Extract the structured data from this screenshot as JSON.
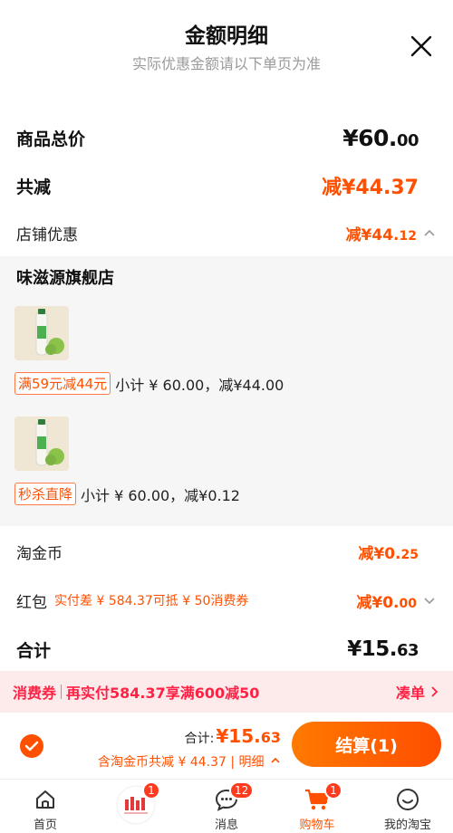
{
  "header": {
    "title": "金额明细",
    "subtitle": "实际优惠金额请以下单页为准"
  },
  "summary": {
    "total_label": "商品总价",
    "total_int": "¥60.",
    "total_dec": "00",
    "reduce_label": "共减",
    "reduce_int": "减¥44.",
    "reduce_dec": "37",
    "store_discount_label": "店铺优惠",
    "store_discount_int": "减¥44.",
    "store_discount_dec": "12"
  },
  "store": {
    "name": "味滋源旗舰店",
    "items": [
      {
        "tag": "满59元减44元",
        "subtotal": "小计 ¥ 60.00，减¥44.00"
      },
      {
        "tag": "秒杀直降",
        "subtotal": "小计 ¥ 60.00，减¥0.12"
      }
    ]
  },
  "coins": {
    "label": "淘金币",
    "value_int": "减¥0.",
    "value_dec": "25"
  },
  "redpacket": {
    "label": "红包",
    "note": "实付差 ¥ 584.37可抵 ¥ 50消费券",
    "value_int": "减¥0.",
    "value_dec": "00"
  },
  "grand": {
    "label": "合计",
    "value_int": "¥15.",
    "value_dec": "63"
  },
  "coupon_bar": {
    "tag": "消费券",
    "text": "再实付584.37享满600减50",
    "action": "凑单"
  },
  "checkout": {
    "total_label": "合计:",
    "total_int": "¥15.",
    "total_dec": "63",
    "discount_text": "含淘金币共减 ¥ 44.37 | 明细",
    "pay_label": "结算(1)"
  },
  "tabbar": {
    "items": [
      {
        "label": "首页",
        "icon": "home-icon",
        "badge": ""
      },
      {
        "label": "",
        "icon": "promo-icon",
        "badge": "1"
      },
      {
        "label": "消息",
        "icon": "message-icon",
        "badge": "12"
      },
      {
        "label": "购物车",
        "icon": "cart-icon",
        "badge": "1"
      },
      {
        "label": "我的淘宝",
        "icon": "profile-icon",
        "badge": ""
      }
    ]
  },
  "colors": {
    "accent": "#ff5000",
    "coupon_bg": "#fdebec",
    "coupon_text": "#ff2244"
  }
}
